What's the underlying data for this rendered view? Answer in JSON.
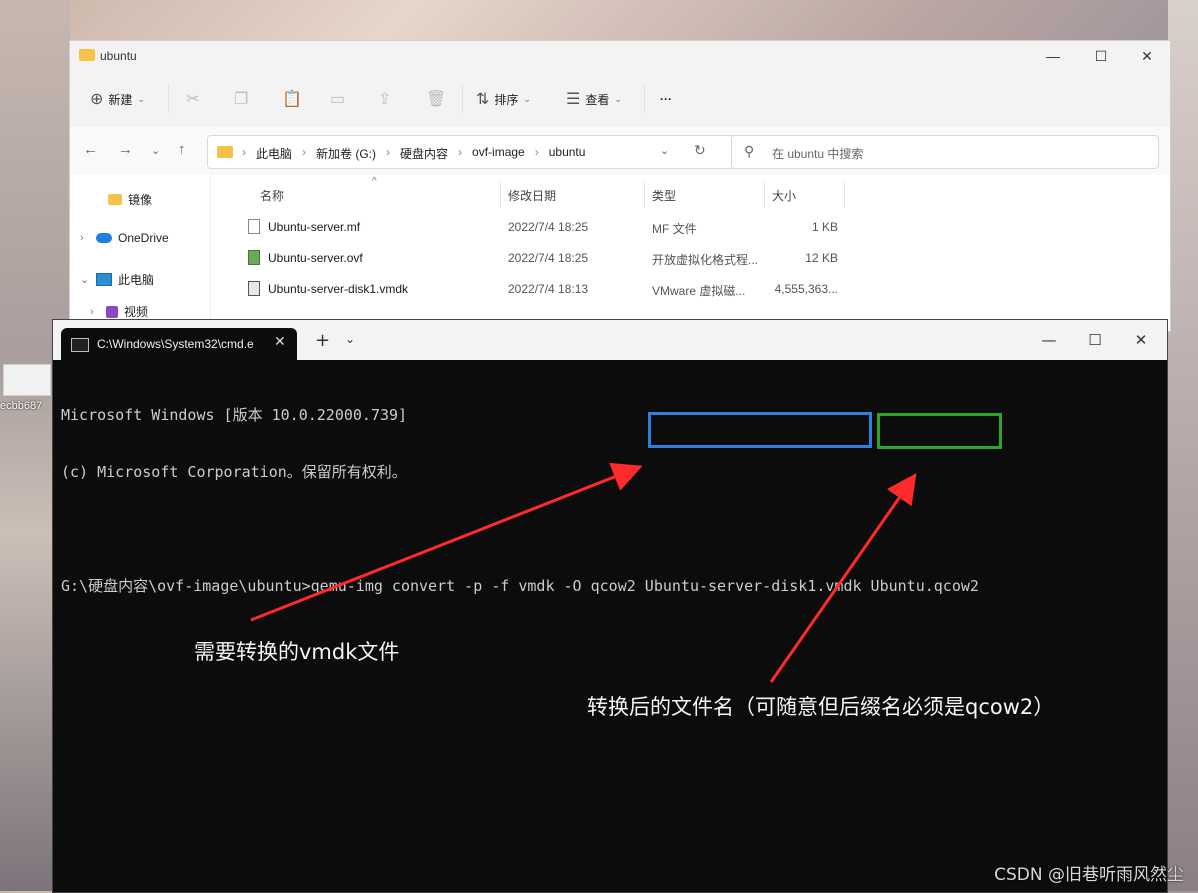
{
  "desktop": {
    "icon_label": "ecbb687"
  },
  "explorer": {
    "title": "ubuntu",
    "window_controls": {
      "minimize": "—",
      "maximize": "☐",
      "close": "✕"
    },
    "toolbar": {
      "new_label": "新建",
      "sort_label": "排序",
      "view_label": "查看",
      "more_label": "···"
    },
    "address": {
      "path": [
        "此电脑",
        "新加卷 (G:)",
        "硬盘内容",
        "ovf-image",
        "ubuntu"
      ]
    },
    "search": {
      "placeholder": "在 ubuntu 中搜索"
    },
    "sidebar": {
      "items": [
        {
          "label": "镜像",
          "icon": "folder-icon"
        },
        {
          "label": "OneDrive",
          "icon": "cloud-icon"
        },
        {
          "label": "此电脑",
          "icon": "computer-icon"
        },
        {
          "label": "视频",
          "icon": "video-icon"
        }
      ]
    },
    "columns": [
      "名称",
      "修改日期",
      "类型",
      "大小"
    ],
    "files": [
      {
        "name": "Ubuntu-server.mf",
        "date": "2022/7/4 18:25",
        "type": "MF 文件",
        "size": "1 KB"
      },
      {
        "name": "Ubuntu-server.ovf",
        "date": "2022/7/4 18:25",
        "type": "开放虚拟化格式程...",
        "size": "12 KB"
      },
      {
        "name": "Ubuntu-server-disk1.vmdk",
        "date": "2022/7/4 18:13",
        "type": "VMware 虚拟磁...",
        "size": "4,555,363..."
      }
    ]
  },
  "terminal": {
    "tab_title": "C:\\Windows\\System32\\cmd.e",
    "lines": [
      "Microsoft Windows [版本 10.0.22000.739]",
      "(c) Microsoft Corporation。保留所有权利。",
      "",
      "G:\\硬盘内容\\ovf-image\\ubuntu>qemu-img convert -p -f vmdk -O qcow2 Ubuntu-server-disk1.vmdk Ubuntu.qcow2"
    ]
  },
  "annotations": {
    "source_label": "需要转换的vmdk文件",
    "target_label": "转换后的文件名（可随意但后缀名必须是qcow2）",
    "arrow_color": "#ff2a2a",
    "source_box_color": "#2e7fe0",
    "target_box_color": "#2aa52a"
  },
  "watermark": "CSDN @旧巷听雨风然尘"
}
